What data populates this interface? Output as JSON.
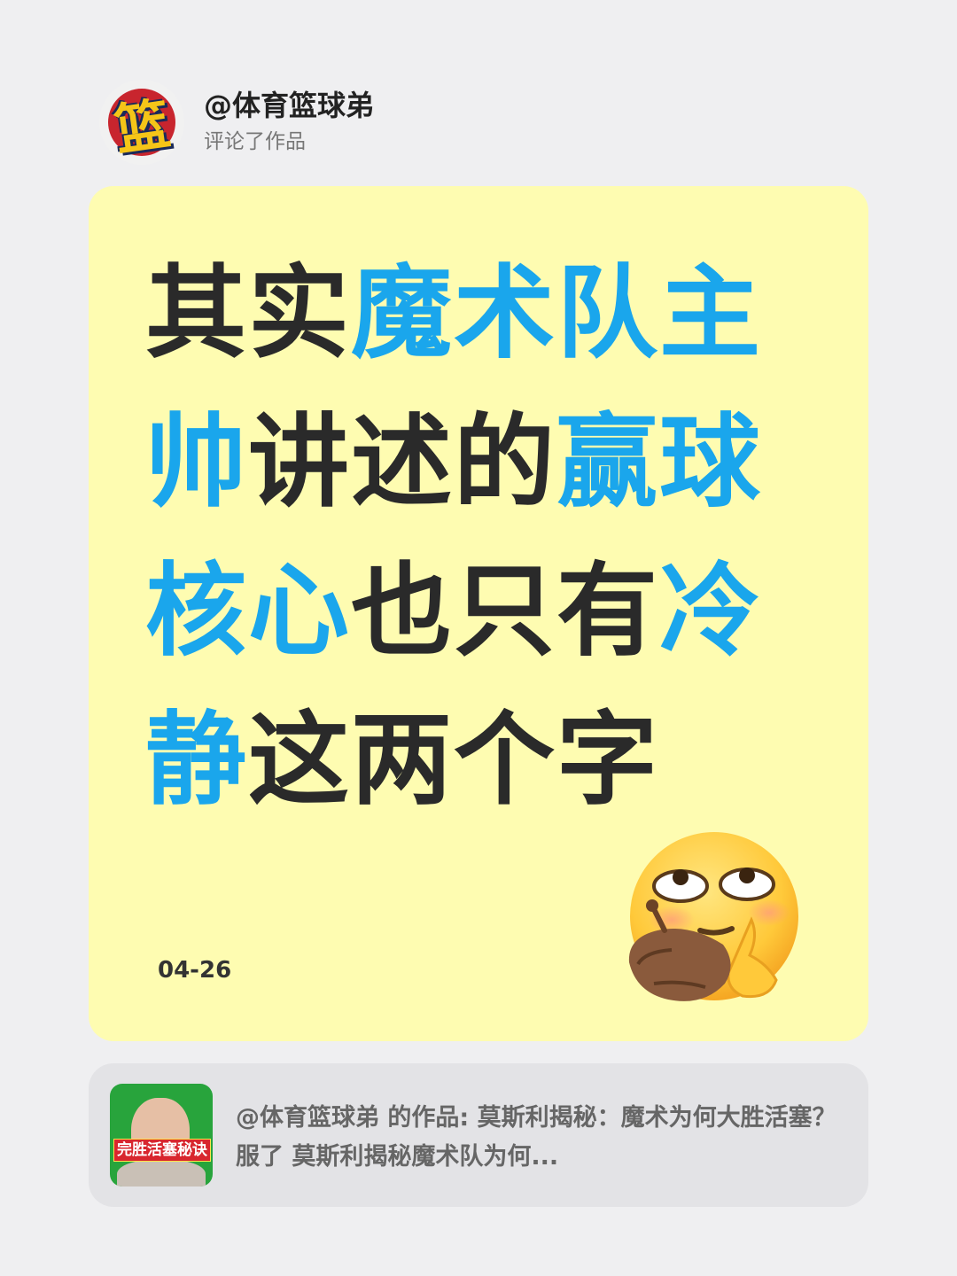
{
  "header": {
    "username": "@体育篮球弟",
    "action": "评论了作品",
    "avatar_char": "篮"
  },
  "card": {
    "headline_segments": [
      [
        {
          "text": "其实",
          "highlight": false
        },
        {
          "text": "魔术队主",
          "highlight": true
        }
      ],
      [
        {
          "text": "帅",
          "highlight": true
        },
        {
          "text": "讲述的",
          "highlight": false
        },
        {
          "text": "赢球",
          "highlight": true
        }
      ],
      [
        {
          "text": "核心",
          "highlight": true
        },
        {
          "text": "也只有",
          "highlight": false
        },
        {
          "text": "冷",
          "highlight": true
        }
      ],
      [
        {
          "text": "静",
          "highlight": true
        },
        {
          "text": "这两个字",
          "highlight": false
        }
      ]
    ],
    "date": "04-26",
    "emoji": "thinking-eye-roll-emoji"
  },
  "link_card": {
    "thumbnail_caption": "完胜活塞秘诀",
    "text": "@体育篮球弟 的作品: 莫斯利揭秘：魔术为何大胜活塞？服了 莫斯利揭秘魔术队为何..."
  },
  "colors": {
    "background": "#EFEFF1",
    "card": "#FEFCB1",
    "highlight": "#1AA6EC",
    "text": "#2A2A2A"
  }
}
